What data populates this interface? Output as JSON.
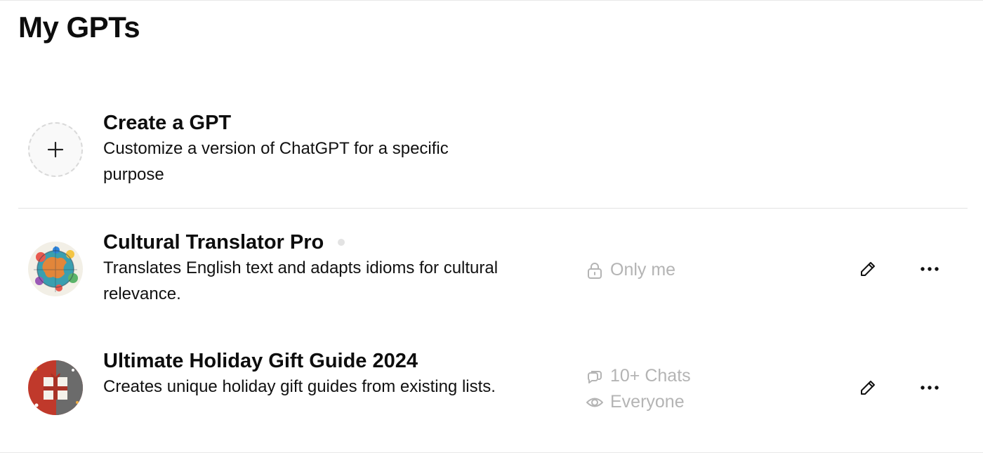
{
  "page": {
    "title": "My GPTs"
  },
  "create": {
    "title": "Create a GPT",
    "description": "Customize a version of ChatGPT for a specific purpose",
    "icon": "plus-icon"
  },
  "gpts": [
    {
      "name": "Cultural Translator Pro",
      "description": "Translates English text and adapts idioms for cultural relevance.",
      "visibility": "Only me",
      "visibility_icon": "lock-icon",
      "has_status_dot": true
    },
    {
      "name": "Ultimate Holiday Gift Guide 2024",
      "description": "Creates unique holiday gift guides from existing lists.",
      "chats": "10+ Chats",
      "chats_icon": "chat-bubbles-icon",
      "visibility": "Everyone",
      "visibility_icon": "eye-icon"
    }
  ],
  "actions": {
    "edit_icon": "pencil-icon",
    "more_icon": "ellipsis-icon"
  },
  "colors": {
    "text": "#0d0d0d",
    "muted": "#b4b4b4",
    "divider": "#e3e3e3"
  }
}
